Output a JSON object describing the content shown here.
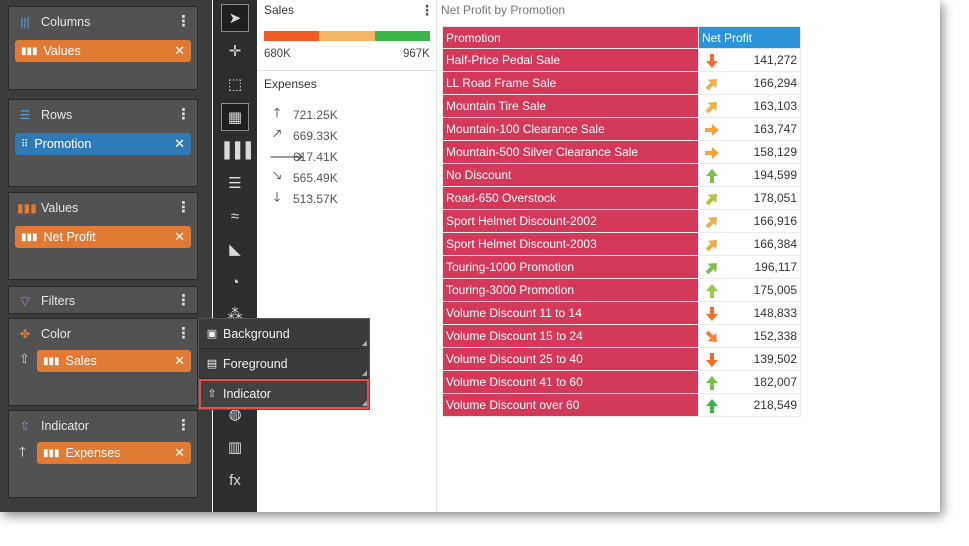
{
  "wells": {
    "columns": {
      "title": "Columns",
      "chip": "Values"
    },
    "rows": {
      "title": "Rows",
      "chip": "Promotion"
    },
    "values": {
      "title": "Values",
      "chip": "Net Profit"
    },
    "filters": {
      "title": "Filters"
    },
    "color": {
      "title": "Color",
      "chip": "Sales"
    },
    "indicator": {
      "title": "Indicator",
      "chip": "Expenses"
    }
  },
  "menu": {
    "items": [
      {
        "label": "Background",
        "icon": "background-fill-icon"
      },
      {
        "label": "Foreground",
        "icon": "foreground-fill-icon"
      },
      {
        "label": "Indicator",
        "icon": "up-arrow-outline-icon"
      }
    ],
    "highlight_color": "#e0504a"
  },
  "legend": {
    "sales_title": "Sales",
    "sales_min": "680K",
    "sales_max": "967K",
    "expenses_title": "Expenses",
    "expense_levels": [
      "721.25K",
      "669.33K",
      "617.41K",
      "565.49K",
      "513.57K"
    ]
  },
  "table": {
    "title": "Net Profit by Promotion",
    "headers": [
      "Promotion",
      "Net Profit"
    ],
    "rows": [
      {
        "promotion": "Half-Price Pedal Sale",
        "net_profit": "141,272",
        "arrow": "down",
        "color": "#f26b2b"
      },
      {
        "promotion": "LL Road Frame Sale",
        "net_profit": "166,294",
        "arrow": "up-right",
        "color": "#e8b04a"
      },
      {
        "promotion": "Mountain Tire Sale",
        "net_profit": "163,103",
        "arrow": "up-right",
        "color": "#e8b04a"
      },
      {
        "promotion": "Mountain-100 Clearance Sale",
        "net_profit": "163,747",
        "arrow": "right",
        "color": "#f4a23a"
      },
      {
        "promotion": "Mountain-500 Silver Clearance Sale",
        "net_profit": "158,129",
        "arrow": "right",
        "color": "#f4a23a"
      },
      {
        "promotion": "No Discount",
        "net_profit": "194,599",
        "arrow": "up",
        "color": "#7cc24a"
      },
      {
        "promotion": "Road-650 Overstock",
        "net_profit": "178,051",
        "arrow": "up-right",
        "color": "#b5c246"
      },
      {
        "promotion": "Sport Helmet Discount-2002",
        "net_profit": "166,916",
        "arrow": "up-right",
        "color": "#e8b04a"
      },
      {
        "promotion": "Sport Helmet Discount-2003",
        "net_profit": "166,384",
        "arrow": "up-right",
        "color": "#e8b04a"
      },
      {
        "promotion": "Touring-1000 Promotion",
        "net_profit": "196,117",
        "arrow": "up-right",
        "color": "#7cc24a"
      },
      {
        "promotion": "Touring-3000 Promotion",
        "net_profit": "175,005",
        "arrow": "up",
        "color": "#9cc84a"
      },
      {
        "promotion": "Volume Discount 11 to 14",
        "net_profit": "148,833",
        "arrow": "down",
        "color": "#f26b2b"
      },
      {
        "promotion": "Volume Discount 15 to 24",
        "net_profit": "152,338",
        "arrow": "down-right",
        "color": "#f2803a"
      },
      {
        "promotion": "Volume Discount 25 to 40",
        "net_profit": "139,502",
        "arrow": "down",
        "color": "#f26b2b"
      },
      {
        "promotion": "Volume Discount 41 to 60",
        "net_profit": "182,007",
        "arrow": "up",
        "color": "#7cc24a"
      },
      {
        "promotion": "Volume Discount over 60",
        "net_profit": "218,549",
        "arrow": "up",
        "color": "#3bb54a"
      }
    ]
  },
  "colors": {
    "promotion_header": "#d4385a",
    "net_profit_header": "#2b94d8",
    "chip_orange": "#e07a35",
    "chip_blue": "#2f7bb8",
    "scale_low": "#f15a24",
    "scale_mid": "#f7b56a",
    "scale_high": "#39b54a"
  },
  "toolbar": {
    "icons": [
      "pointer-icon",
      "move-icon",
      "select-region-icon",
      "grid-icon",
      "bar-chart-icon",
      "text-align-icon",
      "wave-icon",
      "area-chart-icon",
      "pie-chart-icon",
      "scatter-icon",
      "globe-icon",
      "barcode-icon",
      "formula-icon"
    ]
  }
}
